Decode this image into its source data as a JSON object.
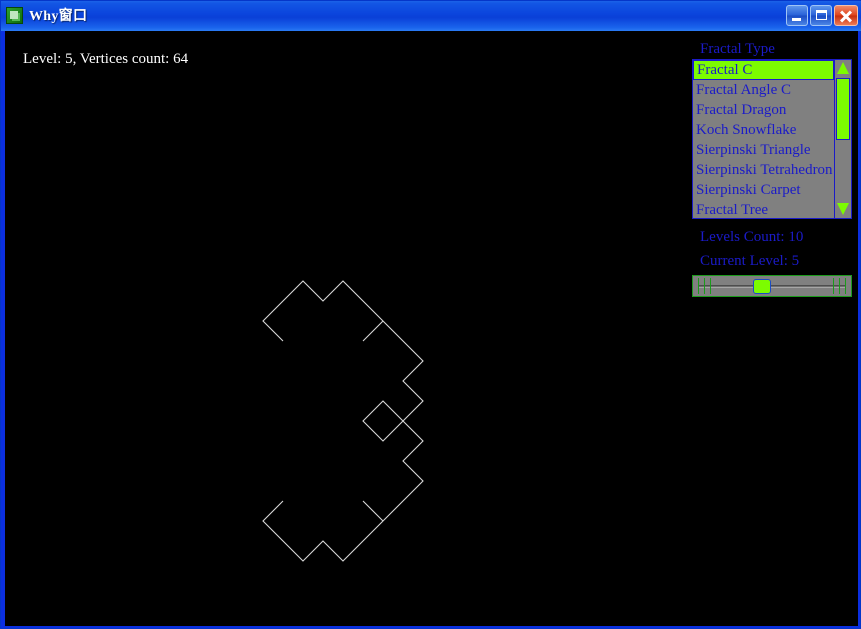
{
  "window": {
    "title": "Why窗口",
    "icon": "app-icon",
    "buttons": {
      "minimize": "Minimize",
      "maximize": "Maximize",
      "close": "Close"
    },
    "colors": {
      "titlebar": "#0b45dd",
      "border": "#0536c9",
      "client_bg": "#000000",
      "accent_green": "#7CFC00",
      "label_blue": "#1b1bc8",
      "control_gray": "#808080",
      "fractal_stroke": "#d8d8d8"
    }
  },
  "canvas": {
    "status_text": "Level: 5, Vertices count: 64",
    "level": 5,
    "vertices_count": 64
  },
  "panel": {
    "fractal_type_label": "Fractal Type",
    "levels_count_label": "Levels Count: 10",
    "current_level_label": "Current Level: 5",
    "levels_count": 10,
    "current_level": 5,
    "fractal_types": [
      "Fractal C",
      "Fractal Angle C",
      "Fractal Dragon",
      "Koch Snowflake",
      "Sierpinski Triangle",
      "Sierpinski Tetrahedron",
      "Sierpinski Carpet",
      "Fractal Tree"
    ],
    "selected_fractal": "Fractal C",
    "selected_index": 0,
    "scrollbar": {
      "up_arrow": "scroll-up-icon",
      "down_arrow": "scroll-down-icon"
    },
    "slider": {
      "min": 1,
      "max": 10,
      "value": 5
    }
  }
}
